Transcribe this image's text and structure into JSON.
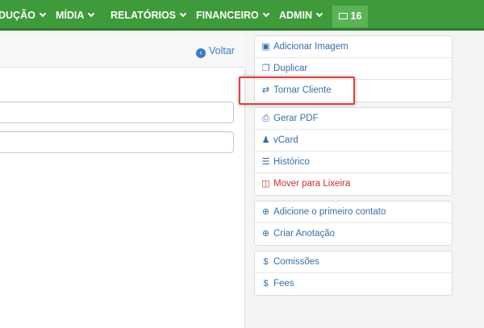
{
  "nav": {
    "items": [
      {
        "label": "DUÇÃO"
      },
      {
        "label": "MÍDIA"
      },
      {
        "label": "RELATÓRIOS"
      },
      {
        "label": "FINANCEIRO"
      },
      {
        "label": "ADMIN"
      }
    ],
    "badge": {
      "count": "16",
      "icon": "envelope-icon"
    }
  },
  "main": {
    "back_label": "Voltar"
  },
  "sidebar": {
    "groups": [
      [
        {
          "label": "Adicionar Imagem",
          "icon": "image-icon"
        },
        {
          "label": "Duplicar",
          "icon": "copy-icon"
        },
        {
          "label": "Tornar Cliente",
          "icon": "retweet-icon"
        }
      ],
      [
        {
          "label": "Gerar PDF",
          "icon": "print-icon"
        },
        {
          "label": "vCard",
          "icon": "user-icon"
        },
        {
          "label": "Histórico",
          "icon": "list-icon"
        },
        {
          "label": "Mover para Lixeira",
          "icon": "trash-icon"
        }
      ],
      [
        {
          "label": "Adicione o primeiro contato",
          "icon": "plus-circle-icon"
        },
        {
          "label": "Criar Anotação",
          "icon": "plus-circle-icon"
        }
      ],
      [
        {
          "label": "Comissões",
          "icon": "dollar-icon"
        },
        {
          "label": "Fees",
          "icon": "dollar-icon"
        }
      ]
    ]
  },
  "colors": {
    "nav_green": "#3e9a3a",
    "link_blue": "#3a6ea8",
    "danger_red": "#c9302c",
    "highlight_red": "#d9453c"
  }
}
